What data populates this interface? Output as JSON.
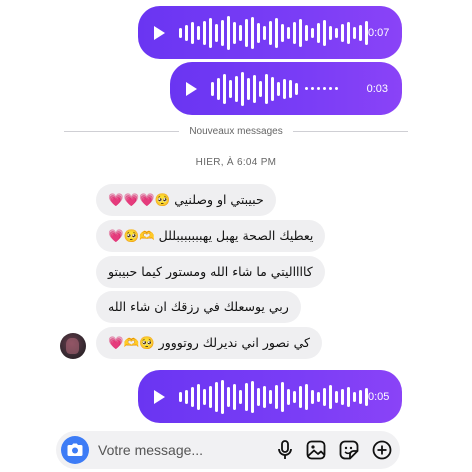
{
  "voice_messages": [
    {
      "duration": "0:07"
    },
    {
      "duration": "0:03"
    },
    {
      "duration": "0:05"
    }
  ],
  "divider_label": "Nouveaux messages",
  "timestamp": "HIER, À 6:04 PM",
  "messages": [
    {
      "text": "حبيبتي او وصلنيي 🥺💗💗💗"
    },
    {
      "text": "يعطيك الصحة يهبل يهبببببببللل 🫶🥺💗"
    },
    {
      "text": "كااااليتي ما شاء الله ومستور كيما حبيبتو"
    },
    {
      "text": "ربي يوسعلك في رزقك ان شاء الله"
    },
    {
      "text": "كي نصور اني نديرلك روتووور 🥺🫶💗"
    }
  ],
  "composer": {
    "placeholder": "Votre message..."
  },
  "icons": {
    "camera": "camera-icon",
    "mic": "microphone-icon",
    "gallery": "image-icon",
    "sticker": "sticker-icon",
    "add": "plus-circle-icon",
    "play": "play-icon"
  },
  "colors": {
    "accent": "#7a3df6",
    "bubble": "#efeff1",
    "camera": "#3d7cf6"
  }
}
